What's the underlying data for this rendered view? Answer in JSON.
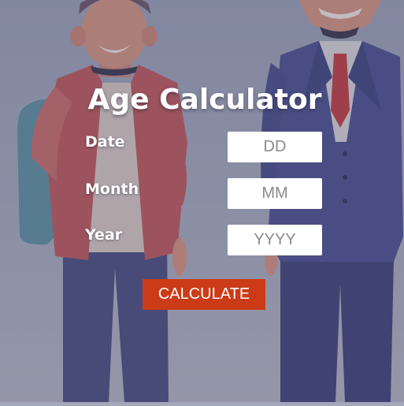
{
  "app": {
    "title": "Age Calculator"
  },
  "form": {
    "fields": [
      {
        "label": "Date",
        "placeholder": "DD",
        "value": ""
      },
      {
        "label": "Month",
        "placeholder": "MM",
        "value": ""
      },
      {
        "label": "Year",
        "placeholder": "YYYY",
        "value": ""
      }
    ],
    "submit_label": "CALCULATE"
  },
  "colors": {
    "button": "#cc3b17",
    "text": "#ffffff",
    "backdrop": "#a3a7ba"
  }
}
